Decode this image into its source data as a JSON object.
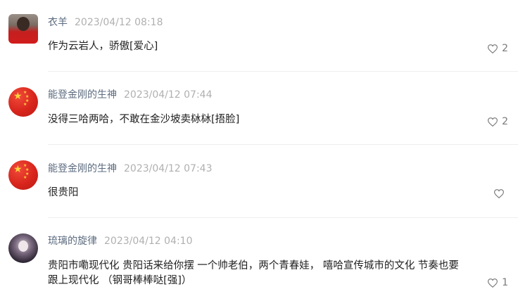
{
  "comments": [
    {
      "username": "衣羊",
      "timestamp": "2023/04/12 08:18",
      "text": "作为云岩人，骄傲[爱心]",
      "likes": "2",
      "avatar": "person-red-shirt"
    },
    {
      "username": "能登金刚的生神",
      "timestamp": "2023/04/12 07:44",
      "text": "没得三哈两哈，不敢在金沙坡卖栤栤[捂脸]",
      "likes": "2",
      "avatar": "red-flag"
    },
    {
      "username": "能登金刚的生神",
      "timestamp": "2023/04/12 07:43",
      "text": "很贵阳",
      "likes": "",
      "avatar": "red-flag"
    },
    {
      "username": "琉璃的旋律",
      "timestamp": "2023/04/12 04:10",
      "text": "贵阳市嘞现代化 贵阳话来给你摆 一个帅老伯，两个青春娃， 嘻哈宣传城市的文化 节奏也要跟上现代化 （钢哥棒棒哒[强]）",
      "likes": "1",
      "avatar": "dark-portrait"
    }
  ],
  "icons": {
    "like": "heart-outline-icon"
  },
  "colors": {
    "username": "#5c6b7f",
    "timestamp": "#b0b0b0",
    "text": "#1f1f1f",
    "like": "#7a7a7a",
    "flag_red": "#d8251c",
    "flag_star": "#ffd23c"
  }
}
